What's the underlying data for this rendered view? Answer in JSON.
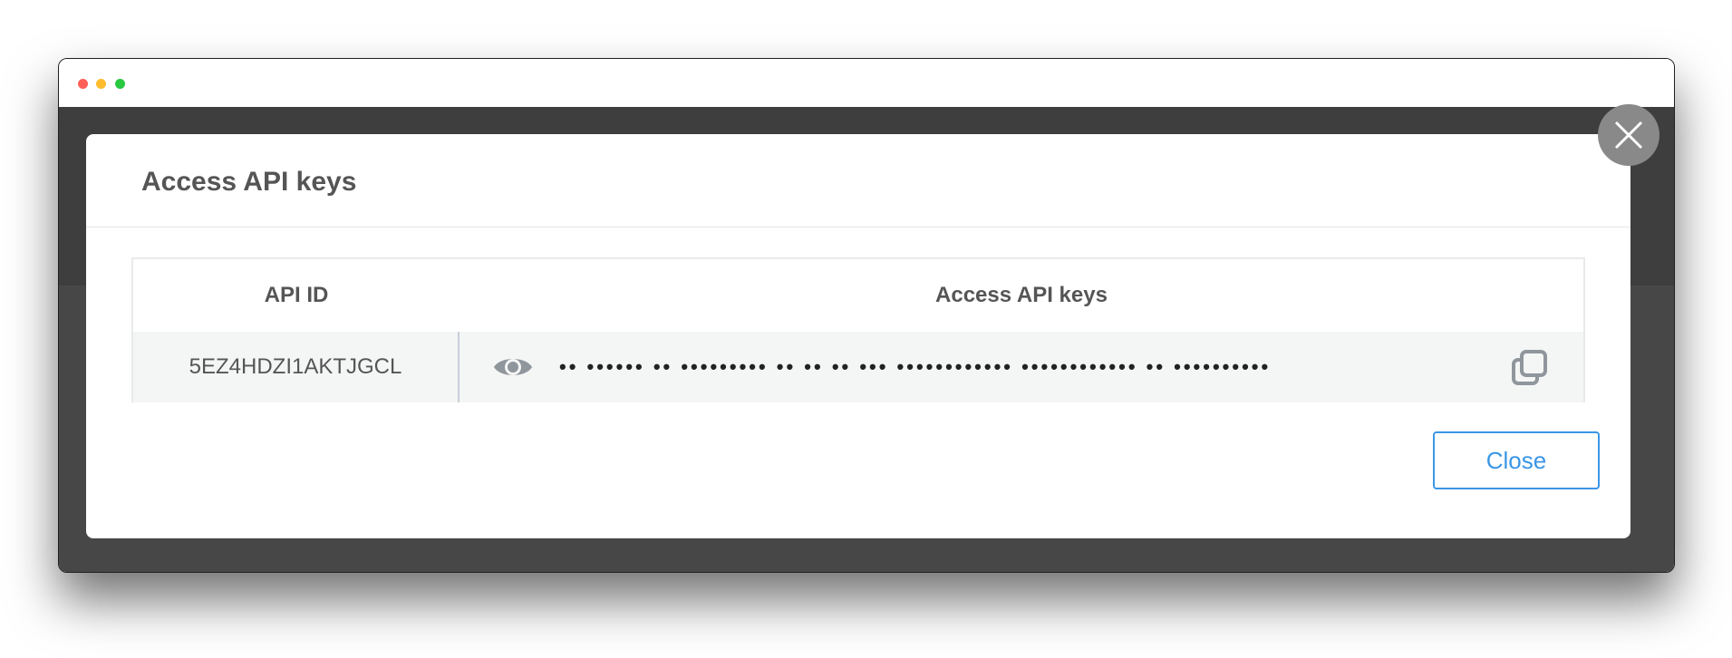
{
  "window": {
    "controls": [
      "close",
      "minimize",
      "zoom"
    ]
  },
  "dialog": {
    "title": "Access API keys",
    "table": {
      "headers": {
        "api_id": "API ID",
        "access_keys": "Access API keys"
      },
      "rows": [
        {
          "api_id": "5EZ4HDZI1AKTJGCL",
          "access_key_masked": "•• •••••• •• ••••••••• •• •• •• ••• •••••••••••• •••••••••••• •• ••••••••••",
          "reveal_icon": "eye-icon",
          "copy_icon": "copy-icon"
        }
      ]
    },
    "close_label": "Close",
    "dismiss_icon": "close-icon"
  },
  "colors": {
    "overlay": "#474747",
    "accent": "#3a96e6",
    "dismiss_button": "#898989"
  }
}
